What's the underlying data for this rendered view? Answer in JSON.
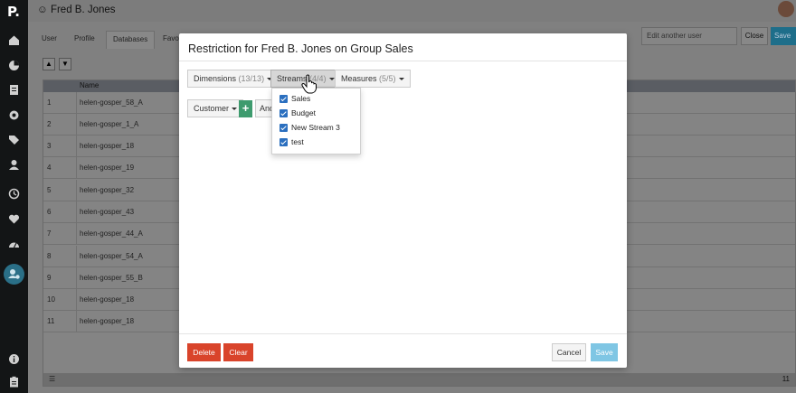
{
  "app": {
    "logo": "P.",
    "title": "Fred B. Jones",
    "tabs": [
      "User",
      "Profile",
      "Databases",
      "Favo"
    ],
    "edit_user_placeholder": "Edit another user",
    "close_label": "Close",
    "save_label": "Save"
  },
  "grid": {
    "column_name": "Name",
    "rows": [
      {
        "num": "1",
        "name": "helen-gosper_58_A"
      },
      {
        "num": "2",
        "name": "helen-gosper_1_A"
      },
      {
        "num": "3",
        "name": "helen-gosper_18"
      },
      {
        "num": "4",
        "name": "helen-gosper_19"
      },
      {
        "num": "5",
        "name": "helen-gosper_32"
      },
      {
        "num": "6",
        "name": "helen-gosper_43"
      },
      {
        "num": "7",
        "name": "helen-gosper_44_A"
      },
      {
        "num": "8",
        "name": "helen-gosper_54_A"
      },
      {
        "num": "9",
        "name": "helen-gosper_55_B"
      },
      {
        "num": "10",
        "name": "helen-gosper_18"
      },
      {
        "num": "11",
        "name": "helen-gosper_18"
      }
    ],
    "footer_count": "11"
  },
  "modal": {
    "title": "Restriction for Fred B. Jones on Group Sales",
    "dimensions_label": "Dimensions",
    "dimensions_count": "(13/13)",
    "streams_label": "Streams",
    "streams_count": "(4/4)",
    "measures_label": "Measures",
    "measures_count": "(5/5)",
    "customer_label": "Customer",
    "and_label": "And",
    "streams": [
      "Sales",
      "Budget",
      "New Stream 3",
      "test"
    ],
    "delete_label": "Delete",
    "clear_label": "Clear",
    "cancel_label": "Cancel",
    "save_label": "Save"
  },
  "colors": {
    "danger": "#d9442b",
    "primary_disabled": "#7fc6e4",
    "add": "#3e9b6e",
    "checkbox": "#2b6fbf"
  }
}
